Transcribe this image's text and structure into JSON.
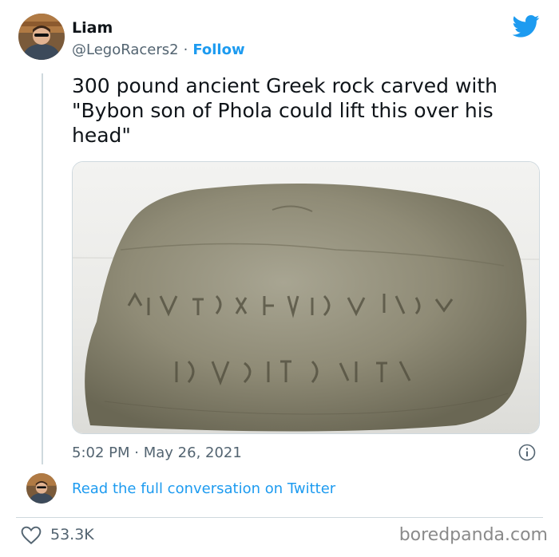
{
  "author": {
    "name": "Liam",
    "handle": "@LegoRacers2",
    "separator": "·",
    "follow_label": "Follow"
  },
  "tweet": {
    "text": "300 pound ancient Greek rock carved with \"Bybon son of Phola could lift this over his head\"",
    "time": "5:02 PM",
    "separator": "·",
    "date": "May 26, 2021"
  },
  "conversation": {
    "link_label": "Read the full conversation on Twitter"
  },
  "engagement": {
    "likes": "53.3K"
  },
  "watermark": "boredpanda.com",
  "icons": {
    "brand": "twitter-bird-icon",
    "info": "info-icon",
    "like": "heart-icon"
  },
  "colors": {
    "accent": "#1d9bf0",
    "secondary_text": "#536471",
    "divider": "#cfd9de"
  }
}
